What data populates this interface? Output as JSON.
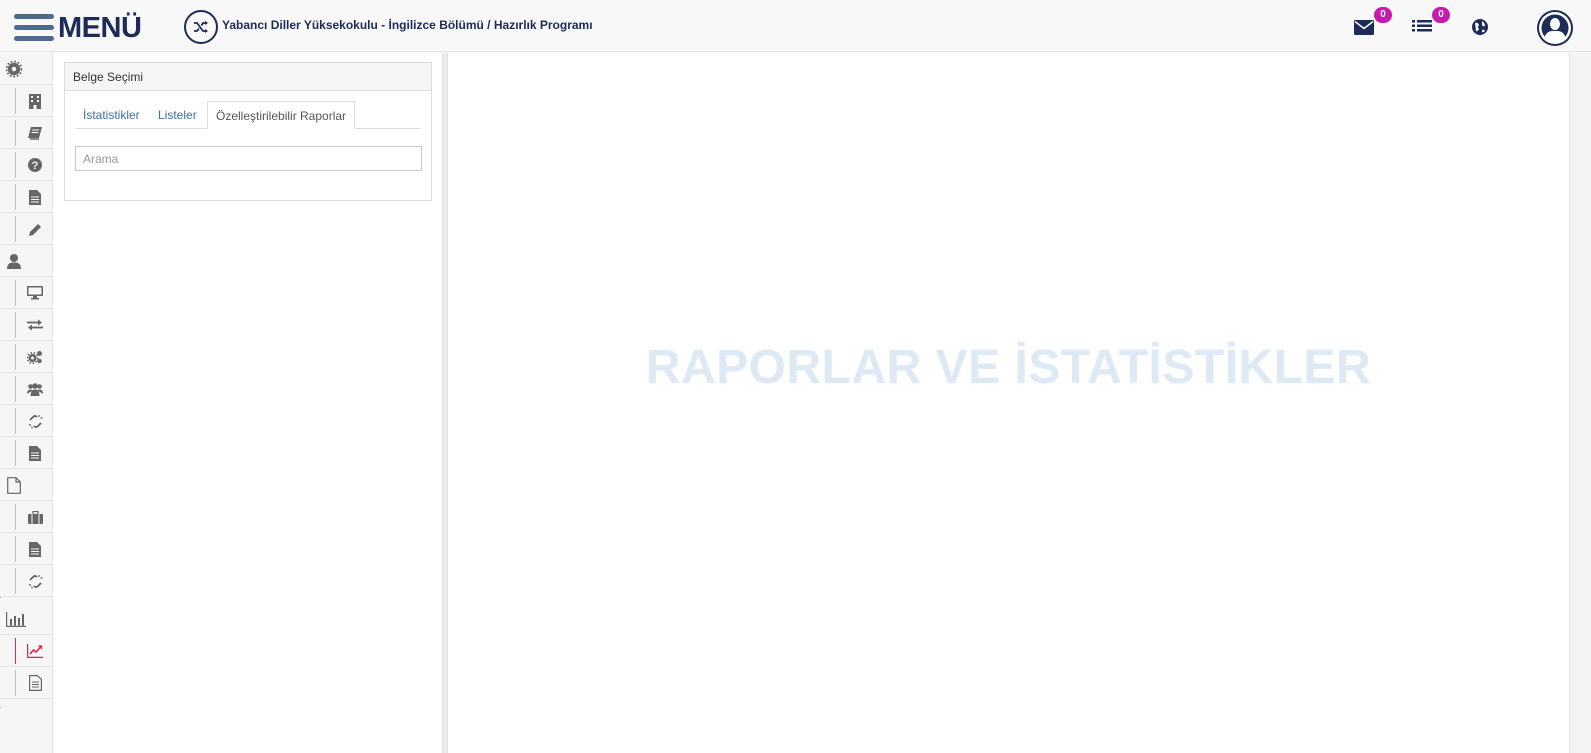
{
  "header": {
    "menu_label": "MENÜ",
    "program_title": "Yabancı Diller Yüksekokulu - İngilizce Bölümü / Hazırlık Programı",
    "messages_count": "0",
    "tasks_count": "0",
    "accent_color": "#1c2b57",
    "badge_color": "#c71bb0"
  },
  "sidebar": {
    "items": [
      {
        "icon": "gear-icon",
        "level": "parent"
      },
      {
        "icon": "building-icon",
        "level": "child"
      },
      {
        "icon": "book-icon",
        "level": "child"
      },
      {
        "icon": "question-icon",
        "level": "child"
      },
      {
        "icon": "document-icon",
        "level": "child"
      },
      {
        "icon": "pencil-icon",
        "level": "child"
      },
      {
        "icon": "user-icon",
        "level": "parent"
      },
      {
        "icon": "monitor-icon",
        "level": "child"
      },
      {
        "icon": "exchange-icon",
        "level": "child"
      },
      {
        "icon": "cogs-icon",
        "level": "child"
      },
      {
        "icon": "users-icon",
        "level": "child"
      },
      {
        "icon": "link-icon",
        "level": "child"
      },
      {
        "icon": "document-icon",
        "level": "child"
      },
      {
        "icon": "file-outline-icon",
        "level": "parent"
      },
      {
        "icon": "briefcase-icon",
        "level": "child"
      },
      {
        "icon": "document-icon",
        "level": "child"
      },
      {
        "icon": "link-icon",
        "level": "child"
      },
      {
        "icon": "bar-chart-icon",
        "level": "parent"
      },
      {
        "icon": "line-chart-icon",
        "level": "child",
        "active": true
      },
      {
        "icon": "file-text-icon",
        "level": "child"
      }
    ]
  },
  "panel": {
    "title": "Belge Seçimi",
    "tabs": [
      {
        "label": "İstatistikler",
        "active": false
      },
      {
        "label": "Listeler",
        "active": false
      },
      {
        "label": "Özelleştirilebilir Raporlar",
        "active": true
      }
    ],
    "search_placeholder": "Arama"
  },
  "main": {
    "watermark": "RAPORLAR VE İSTATİSTİKLER"
  }
}
